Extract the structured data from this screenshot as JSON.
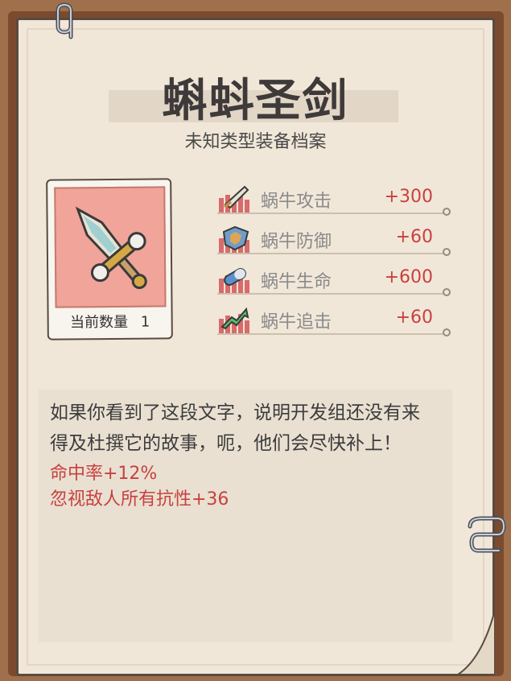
{
  "item": {
    "name": "蝌蚪圣剑",
    "subtitle": "未知类型装备档案",
    "count_label": "当前数量",
    "count_value": "1"
  },
  "stats": [
    {
      "label": "蜗牛攻击",
      "value": "+300",
      "icon": "sword-stat-icon"
    },
    {
      "label": "蜗牛防御",
      "value": "+60",
      "icon": "shield-stat-icon"
    },
    {
      "label": "蜗牛生命",
      "value": "+600",
      "icon": "pill-stat-icon"
    },
    {
      "label": "蜗牛追击",
      "value": "+60",
      "icon": "arrow-stat-icon"
    }
  ],
  "description": {
    "text_line1": "如果你看到了这段文字，说明开发组还没有来",
    "text_line2": "得及杜撰它的故事，呃，他们会尽快补上！",
    "effect1": "命中率+12%",
    "effect2": "忽视敌人所有抗性+36"
  },
  "colors": {
    "accent_red": "#c8413e",
    "card_bg": "#f0a49a",
    "paper": "#f1e7d9",
    "frame": "#7a4b2e"
  }
}
